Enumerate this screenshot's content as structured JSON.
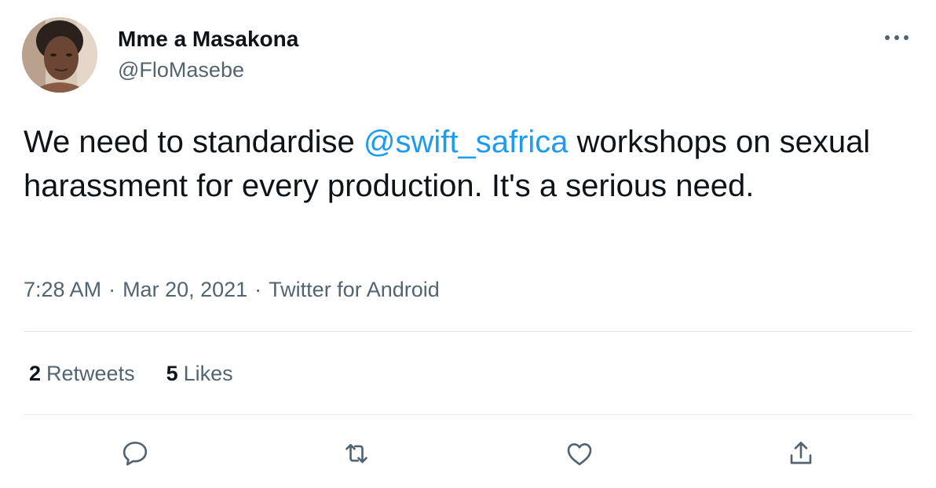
{
  "author": {
    "display_name": "Mme a Masakona",
    "handle": "@FloMasebe"
  },
  "tweet": {
    "text_before": "We need to standardise ",
    "mention": "@swift_safrica",
    "text_after": " workshops on sexual harassment for every production. It's a serious need."
  },
  "meta": {
    "time": "7:28 AM",
    "separator": "·",
    "date": "Mar 20, 2021",
    "source": "Twitter for Android"
  },
  "stats": {
    "retweets_count": "2",
    "retweets_label": "Retweets",
    "likes_count": "5",
    "likes_label": "Likes"
  },
  "actions": [
    "reply-icon",
    "retweet-icon",
    "like-icon",
    "share-icon"
  ],
  "colors": {
    "text": "#0f1419",
    "secondary": "#536471",
    "link": "#1d9bf0",
    "divider": "#e6e9eb"
  }
}
